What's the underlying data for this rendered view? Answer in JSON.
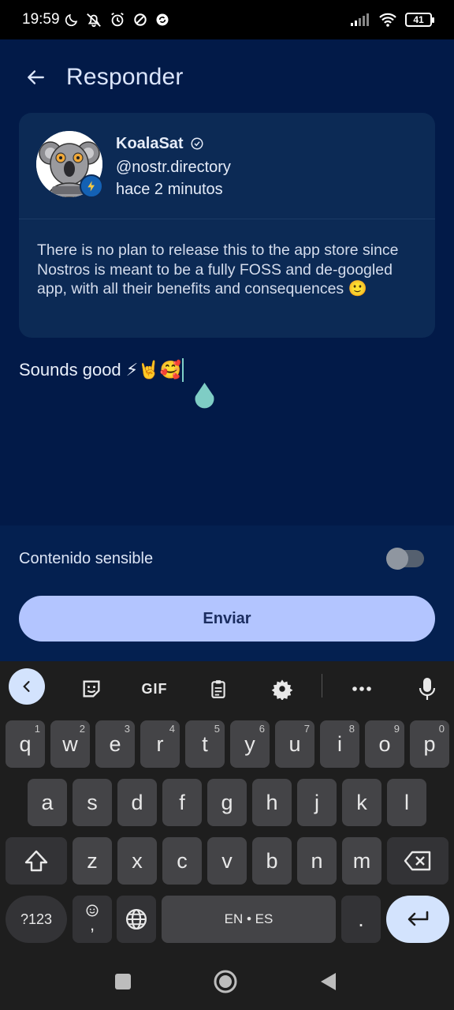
{
  "status_bar": {
    "time": "19:59",
    "battery": "41",
    "icons": [
      "moon-icon",
      "notifications-off-icon",
      "alarm-icon",
      "blocked-icon",
      "sync-icon",
      "signal-icon",
      "wifi-icon",
      "battery-icon"
    ]
  },
  "header": {
    "title": "Responder",
    "back_icon": "arrow-left-icon"
  },
  "quoted_note": {
    "author_name": "KoalaSat",
    "author_handle": "@nostr.directory",
    "timestamp": "hace 2 minutos",
    "text": "There is no plan to release this to the app store since Nostros is meant to be a fully FOSS and de-googled app, with all their benefits and consequences 🙂"
  },
  "compose": {
    "text": "Sounds good ⚡🤘🥰"
  },
  "options": {
    "sensitive_label": "Contenido sensible",
    "sensitive_enabled": false
  },
  "send_button": {
    "label": "Enviar"
  },
  "keyboard": {
    "toolbar": {
      "gif_label": "GIF"
    },
    "row1": [
      {
        "key": "q",
        "hint": "1"
      },
      {
        "key": "w",
        "hint": "2"
      },
      {
        "key": "e",
        "hint": "3"
      },
      {
        "key": "r",
        "hint": "4"
      },
      {
        "key": "t",
        "hint": "5"
      },
      {
        "key": "y",
        "hint": "6"
      },
      {
        "key": "u",
        "hint": "7"
      },
      {
        "key": "i",
        "hint": "8"
      },
      {
        "key": "o",
        "hint": "9"
      },
      {
        "key": "p",
        "hint": "0"
      }
    ],
    "row2": [
      "a",
      "s",
      "d",
      "f",
      "g",
      "h",
      "j",
      "k",
      "l"
    ],
    "row3": [
      "z",
      "x",
      "c",
      "v",
      "b",
      "n",
      "m"
    ],
    "symbols_label": "?123",
    "emoji_key_char": ",",
    "space_label": "EN • ES",
    "period_label": "."
  },
  "colors": {
    "background": "#021a48",
    "card": "#0c2a55",
    "send_button": "#b3c5ff",
    "keyboard": "#1e1e1e",
    "key": "#444447",
    "accent_key": "#d3e3fd"
  }
}
